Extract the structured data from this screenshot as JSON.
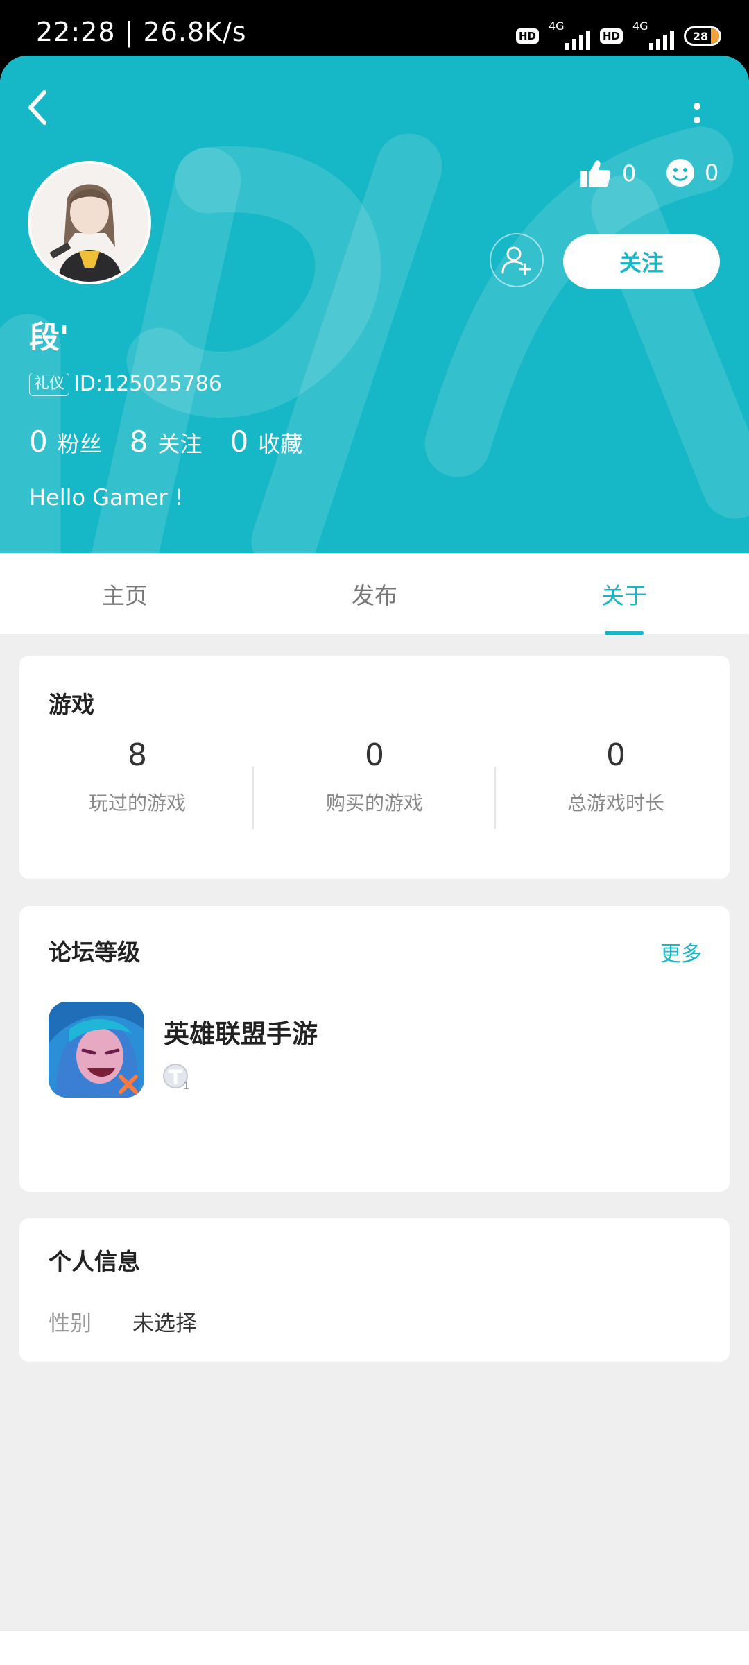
{
  "status_bar": {
    "time_speed": "22:28 | 26.8K/s",
    "hd_label": "HD",
    "network_label": "4G",
    "battery": "28"
  },
  "profile": {
    "name": "段'",
    "id_tag": "礼仪",
    "id_text": "ID:125025786",
    "likes": "0",
    "reactions": "0",
    "follow_button": "关注",
    "stats": [
      {
        "value": "0",
        "label": "粉丝"
      },
      {
        "value": "8",
        "label": "关注"
      },
      {
        "value": "0",
        "label": "收藏"
      }
    ],
    "bio": "Hello Gamer !"
  },
  "tabs": [
    {
      "label": "主页",
      "active": false
    },
    {
      "label": "发布",
      "active": false
    },
    {
      "label": "关于",
      "active": true
    }
  ],
  "games_card": {
    "title": "游戏",
    "stats": [
      {
        "value": "8",
        "label": "玩过的游戏"
      },
      {
        "value": "0",
        "label": "购买的游戏"
      },
      {
        "value": "0",
        "label": "总游戏时长"
      }
    ]
  },
  "forum_card": {
    "title": "论坛等级",
    "more": "更多",
    "game_name": "英雄联盟手游",
    "level_badge": "T1"
  },
  "info_card": {
    "title": "个人信息",
    "gender_label": "性别",
    "gender_value": "未选择"
  },
  "colors": {
    "accent": "#16b7c6",
    "background": "#efefef",
    "card": "#ffffff"
  }
}
